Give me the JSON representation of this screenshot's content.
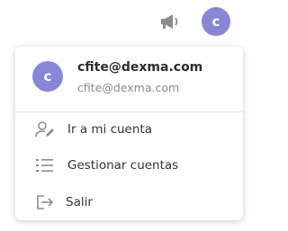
{
  "topbar": {
    "avatar_initial": "c",
    "announcements_icon": "megaphone-icon"
  },
  "menu": {
    "user": {
      "initial": "c",
      "name": "cfite@dexma.com",
      "email": "cfite@dexma.com"
    },
    "items": [
      {
        "label": "Ir a mi cuenta",
        "icon": "user-edit-icon"
      },
      {
        "label": "Gestionar cuentas",
        "icon": "list-icon"
      },
      {
        "label": "Salir",
        "icon": "logout-icon"
      }
    ]
  },
  "colors": {
    "avatar": "#8a86d6",
    "icon": "#8c8c8c",
    "text": "#333333",
    "muted": "#8b8b8b"
  }
}
